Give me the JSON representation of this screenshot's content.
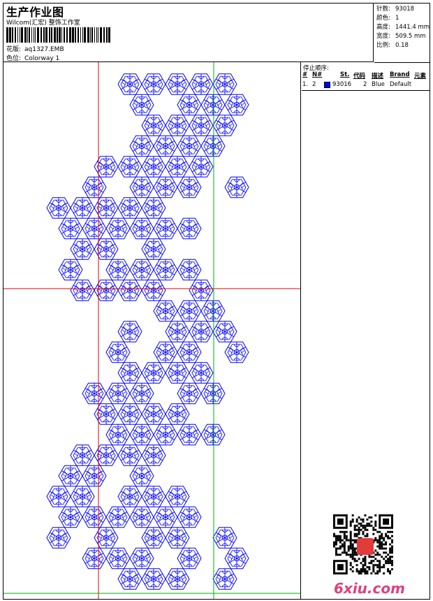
{
  "header": {
    "title": "生产作业图",
    "company": "Wilcom(汇宏) 整饰工作室",
    "design_label": "花版:",
    "design_value": "aq1327.EMB",
    "colorway_label": "色位:",
    "colorway_value": "Colorway 1"
  },
  "stats": {
    "stitches_label": "针数:",
    "stitches_value": "93018",
    "colors_label": "颜色:",
    "colors_value": "1",
    "height_label": "高度:",
    "height_value": "1441.4 mm",
    "width_label": "宽度:",
    "width_value": "509.5 mm",
    "scale_label": "比例:",
    "scale_value": "0.18"
  },
  "stop_sequence": {
    "title": "停止顺序:",
    "columns": [
      "#",
      "N#",
      "St.",
      "代码",
      "描述",
      "Brand",
      "元素"
    ],
    "rows": [
      {
        "index": "1.",
        "needle": "2",
        "swatch_color": "#0000ff",
        "stitches": "93016",
        "code": "2",
        "description": "Blue",
        "brand": "Default"
      }
    ]
  },
  "design": {
    "thread_color": "#0000ff",
    "crosshair_red": "#e00000",
    "guide_green": "#00b000",
    "motif": "hexagonal lace flower"
  },
  "watermark": "6xiu.com"
}
